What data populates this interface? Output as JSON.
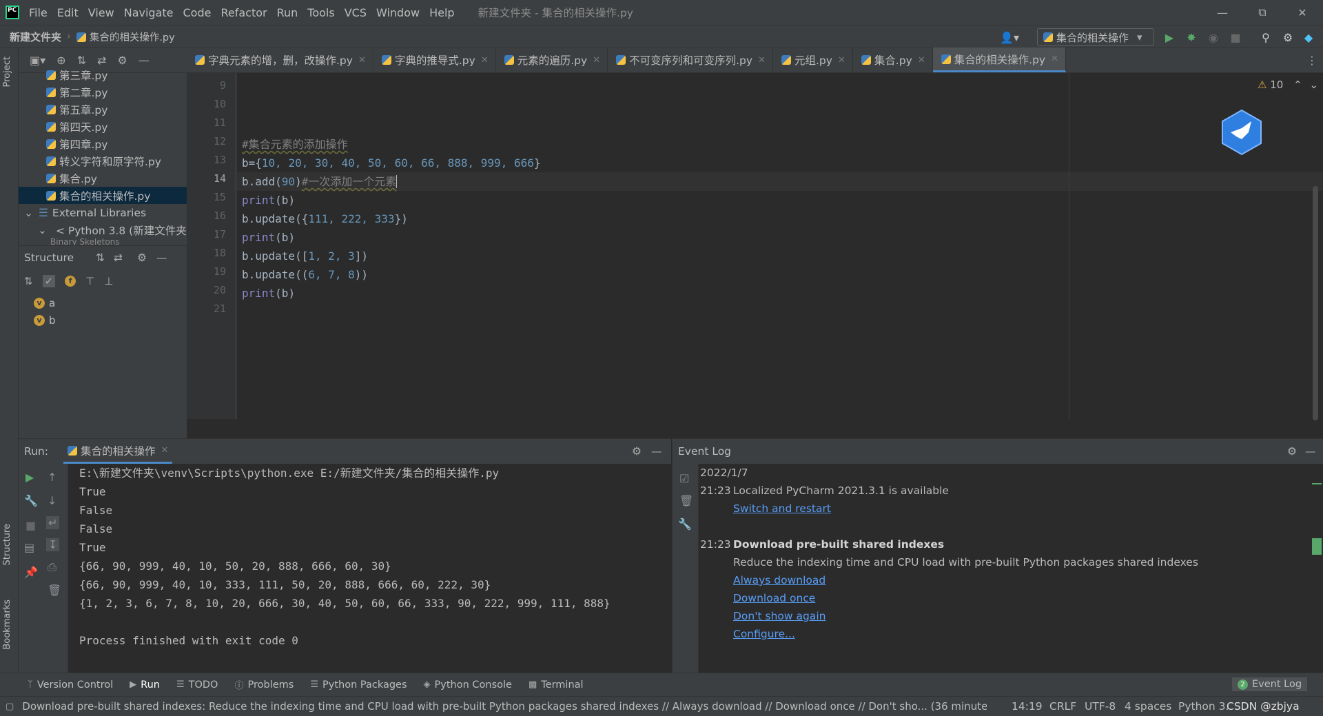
{
  "menu": {
    "items": [
      "File",
      "Edit",
      "View",
      "Navigate",
      "Code",
      "Refactor",
      "Run",
      "Tools",
      "VCS",
      "Window",
      "Help"
    ],
    "window_title": "新建文件夹 - 集合的相关操作.py"
  },
  "nav": {
    "project": "新建文件夹",
    "file": "集合的相关操作.py",
    "run_config": "集合的相关操作"
  },
  "project_tree": {
    "items": [
      "第三章.py",
      "第二章.py",
      "第五章.py",
      "第四天.py",
      "第四章.py",
      "转义字符和原字符.py",
      "集合.py",
      "集合的相关操作.py"
    ],
    "external_libraries": "External Libraries",
    "python_sdk": "< Python 3.8 (新建文件夹)",
    "binary_skeletons": "Binary Skeletons"
  },
  "structure": {
    "title": "Structure",
    "vars": [
      "a",
      "b"
    ],
    "badge": "v"
  },
  "tabs": [
    {
      "label": "字典元素的增，删，改操作.py"
    },
    {
      "label": "字典的推导式.py"
    },
    {
      "label": "元素的遍历.py"
    },
    {
      "label": "不可变序列和可变序列.py"
    },
    {
      "label": "元组.py"
    },
    {
      "label": "集合.py"
    },
    {
      "label": "集合的相关操作.py"
    }
  ],
  "editor": {
    "line_numbers": [
      "9",
      "10",
      "11",
      "12",
      "13",
      "14",
      "15",
      "16",
      "17",
      "18",
      "19",
      "20",
      "21"
    ],
    "warnings": "10",
    "code": {
      "l12": "#集合元素的添加操作",
      "l13_a": "b={",
      "l13_nums": "10, 20, 30, 40, 50, 60, 66, 888, 999, 666",
      "l13_b": "}",
      "l14_a": "b.add(",
      "l14_num": "90",
      "l14_b": ")",
      "l14_cmt": "#一次添加一个元素",
      "print": "print",
      "print_arg": "(b)",
      "l16_a": "b.update({",
      "l16_nums": "111, 222, 333",
      "l16_b": "})",
      "l18_a": "b.update([",
      "l18_nums": "1, 2, 3",
      "l18_b": "])",
      "l19_a": "b.update((",
      "l19_nums": "6, 7, 8",
      "l19_b": "))"
    }
  },
  "run": {
    "label": "Run:",
    "tab": "集合的相关操作",
    "output": [
      "E:\\新建文件夹\\venv\\Scripts\\python.exe E:/新建文件夹/集合的相关操作.py",
      "True",
      "False",
      "False",
      "True",
      "{66, 90, 999, 40, 10, 50, 20, 888, 666, 60, 30}",
      "{66, 90, 999, 40, 10, 333, 111, 50, 20, 888, 666, 60, 222, 30}",
      "{1, 2, 3, 6, 7, 8, 10, 20, 666, 30, 40, 50, 60, 66, 333, 90, 222, 999, 111, 888}",
      "",
      "Process finished with exit code 0"
    ]
  },
  "event_log": {
    "title": "Event Log",
    "date": "2022/1/7",
    "e1_time": "21:23",
    "e1_text": "Localized PyCharm 2021.3.1 is available",
    "e1_link": "Switch and restart",
    "e2_time": "21:23",
    "e2_title": "Download pre-built shared indexes",
    "e2_text": "Reduce the indexing time and CPU load with pre-built Python packages shared indexes",
    "e2_links": [
      "Always download",
      "Download once",
      "Don't show again",
      "Configure..."
    ]
  },
  "bottom_tabs": [
    "Version Control",
    "Run",
    "TODO",
    "Problems",
    "Python Packages",
    "Python Console",
    "Terminal"
  ],
  "event_log_tab": "Event Log",
  "event_log_count": "2",
  "side_tabs": {
    "project": "Project",
    "structure": "Structure",
    "bookmarks": "Bookmarks"
  },
  "status": {
    "message": "Download pre-built shared indexes: Reduce the indexing time and CPU load with pre-built Python packages shared indexes // Always download // Download once // Don't sho... (36 minutes agc",
    "position": "14:19",
    "line_sep": "CRLF",
    "encoding": "UTF-8",
    "indent": "4 spaces",
    "interpreter": "Python 3.",
    "watermark": "CSDN @zbjya"
  },
  "colors": {
    "accent": "#4a88c7",
    "number": "#6897bb",
    "comment": "#808080",
    "link": "#589df6",
    "run_green": "#59a869"
  }
}
